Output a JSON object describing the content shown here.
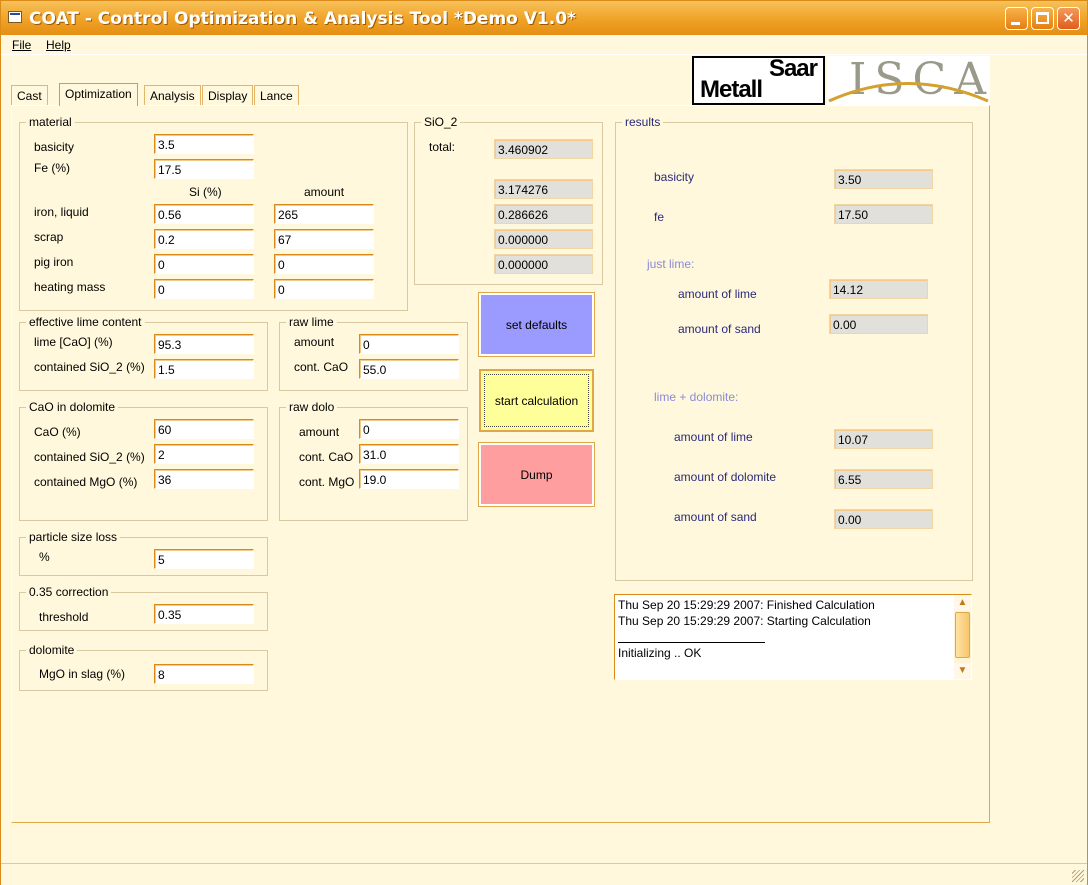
{
  "window": {
    "title": "COAT - Control Optimization & Analysis Tool *Demo V1.0*"
  },
  "menu": {
    "file": "File",
    "help": "Help"
  },
  "logos": {
    "saar_line1": "Saar",
    "saar_line2": "Metall",
    "isca": "ISCA"
  },
  "tabs": [
    "Cast",
    "Optimization",
    "Analysis",
    "Display",
    "Lance"
  ],
  "material": {
    "title": "material",
    "basicity_label": "basicity",
    "basicity": "3.5",
    "fe_label": "Fe (%)",
    "fe": "17.5",
    "si_header": "Si (%)",
    "amount_header": "amount",
    "rows": [
      {
        "label": "iron, liquid",
        "si": "0.56",
        "amount": "265"
      },
      {
        "label": "scrap",
        "si": "0.2",
        "amount": "67"
      },
      {
        "label": "pig iron",
        "si": "0",
        "amount": "0"
      },
      {
        "label": "heating mass",
        "si": "0",
        "amount": "0"
      }
    ]
  },
  "sio2": {
    "title": "SiO_2",
    "total_label": "total:",
    "total": "3.460902",
    "values": [
      "3.174276",
      "0.286626",
      "0.000000",
      "0.000000"
    ]
  },
  "eff_lime": {
    "title": "effective lime content",
    "lime_label": "lime [CaO] (%)",
    "lime": "95.3",
    "sio2_label": "contained SiO_2 (%)",
    "sio2": "1.5"
  },
  "raw_lime": {
    "title": "raw lime",
    "amount_label": "amount",
    "amount": "0",
    "cao_label": "cont. CaO",
    "cao": "55.0"
  },
  "cao_dolomite": {
    "title": "CaO in dolomite",
    "cao_label": "CaO (%)",
    "cao": "60",
    "sio2_label": "contained SiO_2 (%)",
    "sio2": "2",
    "mgo_label": "contained MgO (%)",
    "mgo": "36"
  },
  "raw_dolo": {
    "title": "raw dolo",
    "amount_label": "amount",
    "amount": "0",
    "cao_label": "cont. CaO",
    "cao": "31.0",
    "mgo_label": "cont. MgO",
    "mgo": "19.0"
  },
  "particle": {
    "title": "particle size loss",
    "label": "%",
    "value": "5"
  },
  "correction": {
    "title": "0.35 correction",
    "label": "threshold",
    "value": "0.35"
  },
  "dolomite": {
    "title": "dolomite",
    "label": "MgO in slag (%)",
    "value": "8"
  },
  "buttons": {
    "defaults": "set defaults",
    "start": "start calculation",
    "dump": "Dump"
  },
  "results": {
    "title": "results",
    "basicity_label": "basicity",
    "basicity": "3.50",
    "fe_label": "fe",
    "fe": "17.50",
    "just_lime_head": "just lime:",
    "jl_lime_label": "amount of lime",
    "jl_lime": "14.12",
    "jl_sand_label": "amount of sand",
    "jl_sand": "0.00",
    "lime_dolo_head": "lime + dolomite:",
    "ld_lime_label": "amount of lime",
    "ld_lime": "10.07",
    "ld_dolo_label": "amount of dolomite",
    "ld_dolo": "6.55",
    "ld_sand_label": "amount of sand",
    "ld_sand": "0.00"
  },
  "log": [
    "Thu Sep 20 15:29:29 2007: Finished Calculation",
    "Thu Sep 20 15:29:29 2007: Starting Calculation",
    "Initializing .. OK"
  ],
  "colors": {
    "titlebar": "#f0a226",
    "window_bg": "#fff8dc",
    "field_border": "#d98a17",
    "set_defaults": "#9a9aff",
    "start_calculation": "#ffff99",
    "dump": "#ff9e9e",
    "result_label": "#2a2a7a",
    "result_heading": "#8a8ad8"
  }
}
